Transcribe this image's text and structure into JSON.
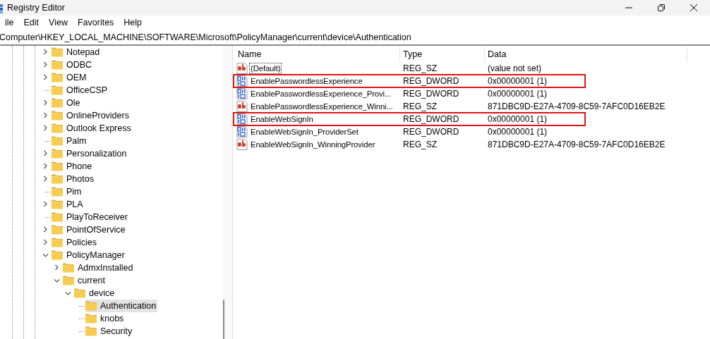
{
  "window": {
    "title": "Registry Editor"
  },
  "menu": [
    "ile",
    "Edit",
    "View",
    "Favorites",
    "Help"
  ],
  "address": "Computer\\HKEY_LOCAL_MACHINE\\SOFTWARE\\Microsoft\\PolicyManager\\current\\device\\Authentication",
  "tree": [
    {
      "label": "Notepad",
      "expandable": true,
      "expanded": false,
      "selected": false
    },
    {
      "label": "ODBC",
      "expandable": true,
      "expanded": false,
      "selected": false
    },
    {
      "label": "OEM",
      "expandable": true,
      "expanded": false,
      "selected": false
    },
    {
      "label": "OfficeCSP",
      "expandable": false,
      "selected": false
    },
    {
      "label": "Ole",
      "expandable": true,
      "expanded": false,
      "selected": false
    },
    {
      "label": "OnlineProviders",
      "expandable": true,
      "expanded": false,
      "selected": false
    },
    {
      "label": "Outlook Express",
      "expandable": true,
      "expanded": false,
      "selected": false
    },
    {
      "label": "Palm",
      "expandable": false,
      "selected": false
    },
    {
      "label": "Personalization",
      "expandable": true,
      "expanded": false,
      "selected": false
    },
    {
      "label": "Phone",
      "expandable": true,
      "expanded": false,
      "selected": false
    },
    {
      "label": "Photos",
      "expandable": true,
      "expanded": false,
      "selected": false
    },
    {
      "label": "Pim",
      "expandable": false,
      "selected": false
    },
    {
      "label": "PLA",
      "expandable": true,
      "expanded": false,
      "selected": false
    },
    {
      "label": "PlayToReceiver",
      "expandable": false,
      "selected": false
    },
    {
      "label": "PointOfService",
      "expandable": true,
      "expanded": false,
      "selected": false
    },
    {
      "label": "Policies",
      "expandable": true,
      "expanded": false,
      "selected": false
    },
    {
      "label": "PolicyManager",
      "expandable": true,
      "expanded": true,
      "selected": false,
      "children": [
        {
          "label": "AdmxInstalled",
          "expandable": true,
          "expanded": false,
          "selected": false
        },
        {
          "label": "current",
          "expandable": true,
          "expanded": true,
          "selected": false,
          "children": [
            {
              "label": "device",
              "expandable": true,
              "expanded": true,
              "selected": false,
              "children": [
                {
                  "label": "Authentication",
                  "expandable": false,
                  "selected": true
                },
                {
                  "label": "knobs",
                  "expandable": false,
                  "selected": false
                },
                {
                  "label": "Security",
                  "expandable": false,
                  "selected": false
                }
              ]
            }
          ]
        }
      ]
    }
  ],
  "list": {
    "columns": [
      "Name",
      "Type",
      "Data"
    ],
    "rows": [
      {
        "kind": "sz",
        "name": "(Default)",
        "type": "REG_SZ",
        "data": "(value not set)",
        "focused": true,
        "highlighted": false
      },
      {
        "kind": "dword",
        "name": "EnablePasswordlessExperience",
        "type": "REG_DWORD",
        "data": "0x00000001 (1)",
        "focused": false,
        "highlighted": true
      },
      {
        "kind": "dword",
        "name": "EnablePasswordlessExperience_Provi...",
        "type": "REG_DWORD",
        "data": "0x00000001 (1)",
        "focused": false,
        "highlighted": false
      },
      {
        "kind": "sz",
        "name": "EnablePasswordlessExperience_Winni...",
        "type": "REG_SZ",
        "data": "871DBC9D-E27A-4709-8C59-7AFC0D16EB2E",
        "focused": false,
        "highlighted": false
      },
      {
        "kind": "dword",
        "name": "EnableWebSignIn",
        "type": "REG_DWORD",
        "data": "0x00000001 (1)",
        "focused": false,
        "highlighted": true
      },
      {
        "kind": "dword",
        "name": "EnableWebSignIn_ProviderSet",
        "type": "REG_DWORD",
        "data": "0x00000001 (1)",
        "focused": false,
        "highlighted": false
      },
      {
        "kind": "sz",
        "name": "EnableWebSignIn_WinningProvider",
        "type": "REG_SZ",
        "data": "871DBC9D-E27A-4709-8C59-7AFC0D16EB2E",
        "focused": false,
        "highlighted": false
      }
    ]
  }
}
